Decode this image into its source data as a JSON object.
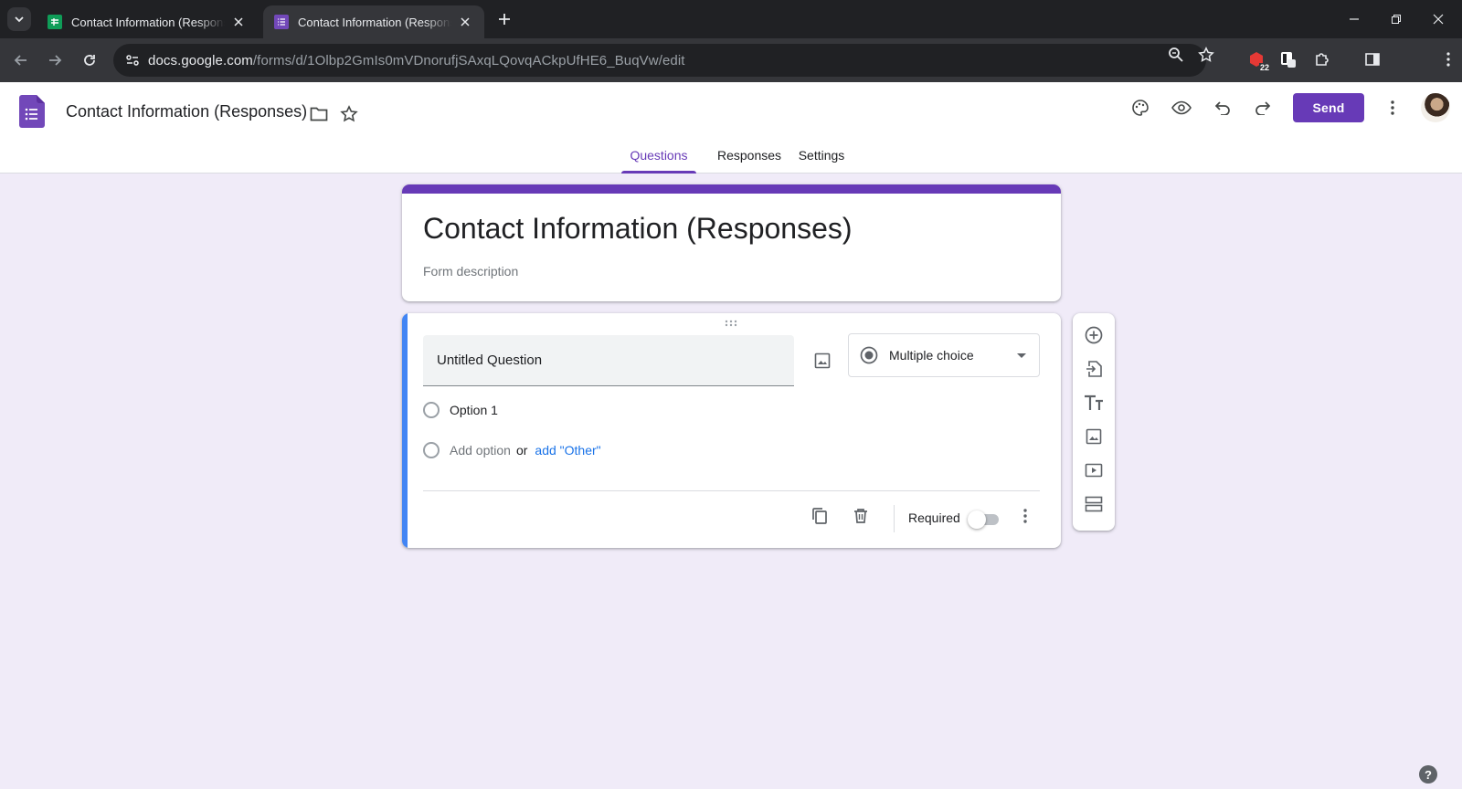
{
  "browser": {
    "tabs": [
      {
        "title": "Contact Information (Responses)",
        "favicon": "google-sheets-icon",
        "active": false
      },
      {
        "title": "Contact Information (Responses)",
        "favicon": "google-forms-icon",
        "active": true
      }
    ],
    "url_host": "docs.google.com",
    "url_path": "/forms/d/1Olbp2GmIs0mVDnorufjSAxqLQovqACkpUfHE6_BuqVw/edit",
    "extension_badge": "22"
  },
  "header": {
    "doc_title": "Contact Information (Responses)",
    "send_label": "Send",
    "tabs": [
      "Questions",
      "Responses",
      "Settings"
    ],
    "active_tab": "Questions"
  },
  "form": {
    "title": "Contact Information (Responses)",
    "description_placeholder": "Form description",
    "question": {
      "title": "Untitled Question",
      "type": "Multiple choice",
      "options": [
        "Option 1"
      ],
      "add_option_label": "Add option",
      "or_label": "or",
      "add_other_label": "add \"Other\"",
      "required_label": "Required",
      "required": false
    }
  },
  "colors": {
    "brand": "#673ab7",
    "active_question_accent": "#4285f4",
    "background": "#f0ebf8",
    "link": "#1a73e8"
  }
}
